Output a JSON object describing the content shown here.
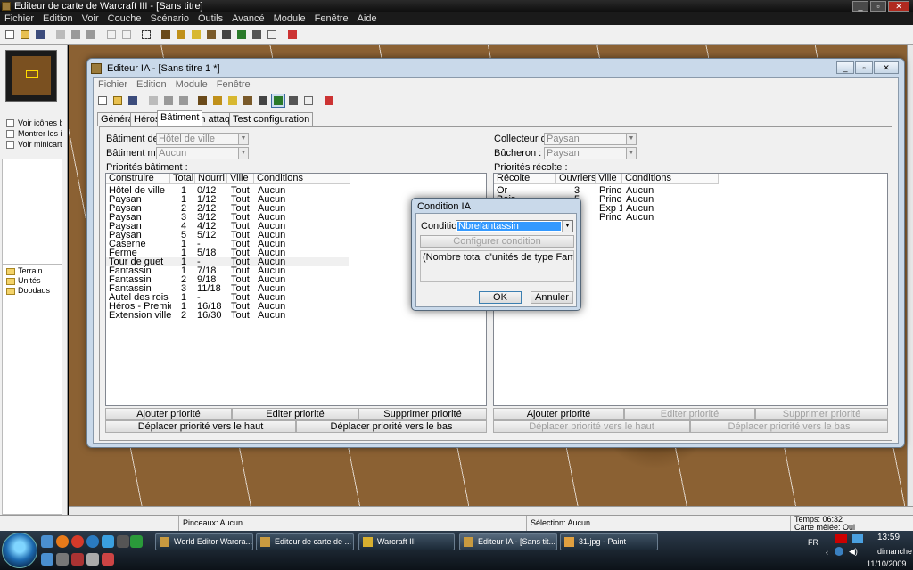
{
  "app": {
    "title": "Editeur de carte de Warcraft III - [Sans titre]",
    "menu": [
      "Fichier",
      "Edition",
      "Voir",
      "Couche",
      "Scénario",
      "Outils",
      "Avancé",
      "Module",
      "Fenêtre",
      "Aide"
    ],
    "left_checkboxes": [
      "Voir icônes b",
      "Montrer les ic",
      "Voir minicarte"
    ],
    "tree_items": [
      "Terrain",
      "Unités",
      "Doodads"
    ],
    "status": {
      "brush": "Pinceaux: Aucun",
      "selection": "Sélection: Aucun",
      "time": "Temps: 06:32",
      "melee": "Carte mêlée: Oui"
    }
  },
  "ia_window": {
    "title": "Editeur IA - [Sans titre 1 *]",
    "menu": [
      "Fichier",
      "Edition",
      "Module",
      "Fenêtre"
    ],
    "tabs": [
      "Général",
      "Héros",
      "Bâtiment",
      "En attaque",
      "Test configuration"
    ],
    "active_tab": "Bâtiment",
    "fields": {
      "batiment_de_label": "Bâtiment de",
      "batiment_de_value": "Hôtel de ville",
      "batiment_minier_label": "Bâtiment minier :",
      "batiment_minier_value": "Aucun",
      "collecteur_label": "Collecteur d'or :",
      "collecteur_value": "Paysan",
      "bucheron_label": "Bûcheron :",
      "bucheron_value": "Paysan"
    },
    "build_priorities": {
      "label": "Priorités bâtiment :",
      "headers": [
        "Construire",
        "Total",
        "Nourri...",
        "Ville",
        "Conditions"
      ],
      "rows": [
        [
          "Hôtel de ville",
          "1",
          "0/12",
          "Tout",
          "Aucun"
        ],
        [
          "Paysan",
          "1",
          "1/12",
          "Tout",
          "Aucun"
        ],
        [
          "Paysan",
          "2",
          "2/12",
          "Tout",
          "Aucun"
        ],
        [
          "Paysan",
          "3",
          "3/12",
          "Tout",
          "Aucun"
        ],
        [
          "Paysan",
          "4",
          "4/12",
          "Tout",
          "Aucun"
        ],
        [
          "Paysan",
          "5",
          "5/12",
          "Tout",
          "Aucun"
        ],
        [
          "Caserne",
          "1",
          "-",
          "Tout",
          "Aucun"
        ],
        [
          "Ferme",
          "1",
          "5/18",
          "Tout",
          "Aucun"
        ],
        [
          "Tour de guet",
          "1",
          "-",
          "Tout",
          "Aucun"
        ],
        [
          "Fantassin",
          "1",
          "7/18",
          "Tout",
          "Aucun"
        ],
        [
          "Fantassin",
          "2",
          "9/18",
          "Tout",
          "Aucun"
        ],
        [
          "Fantassin",
          "3",
          "11/18",
          "Tout",
          "Aucun"
        ],
        [
          "Autel des rois",
          "1",
          "-",
          "Tout",
          "Aucun"
        ],
        [
          "Héros - Premier",
          "1",
          "16/18",
          "Tout",
          "Aucun"
        ],
        [
          "Extension ville",
          "2",
          "16/30",
          "Tout",
          "Aucun"
        ]
      ],
      "buttons": [
        "Ajouter priorité",
        "Editer priorité",
        "Supprimer priorité",
        "Déplacer priorité vers le haut",
        "Déplacer priorité vers le bas"
      ]
    },
    "harvest_priorities": {
      "label": "Priorités récolte :",
      "headers": [
        "Récolte",
        "Ouvriers",
        "Ville",
        "Conditions"
      ],
      "rows": [
        [
          "Or",
          "3",
          "Princ...",
          "Aucun"
        ],
        [
          "Bois",
          "5",
          "Princ...",
          "Aucun"
        ],
        [
          "",
          "",
          "Exp 1",
          "Aucun"
        ],
        [
          "",
          "",
          "Princ...",
          "Aucun"
        ]
      ],
      "buttons": [
        "Ajouter priorité",
        "Editer priorité",
        "Supprimer priorité",
        "Déplacer priorité vers le haut",
        "Déplacer priorité vers le bas"
      ]
    }
  },
  "condition_dialog": {
    "title": "Condition IA",
    "condition_label": "Condition",
    "condition_value": "Nbrefantassin",
    "configure_button": "Configurer condition",
    "description": "(Nombre total d'unités de type  Fantassin) Egal à 3",
    "ok": "OK",
    "cancel": "Annuler"
  },
  "taskbar": {
    "tasks": [
      "World Editor Warcra...",
      "Editeur de carte de ...",
      "Warcraft III",
      "Editeur IA - [Sans tit...",
      "31.jpg - Paint"
    ],
    "lang": "FR",
    "time": "13:59",
    "day": "dimanche",
    "date": "11/10/2009"
  }
}
